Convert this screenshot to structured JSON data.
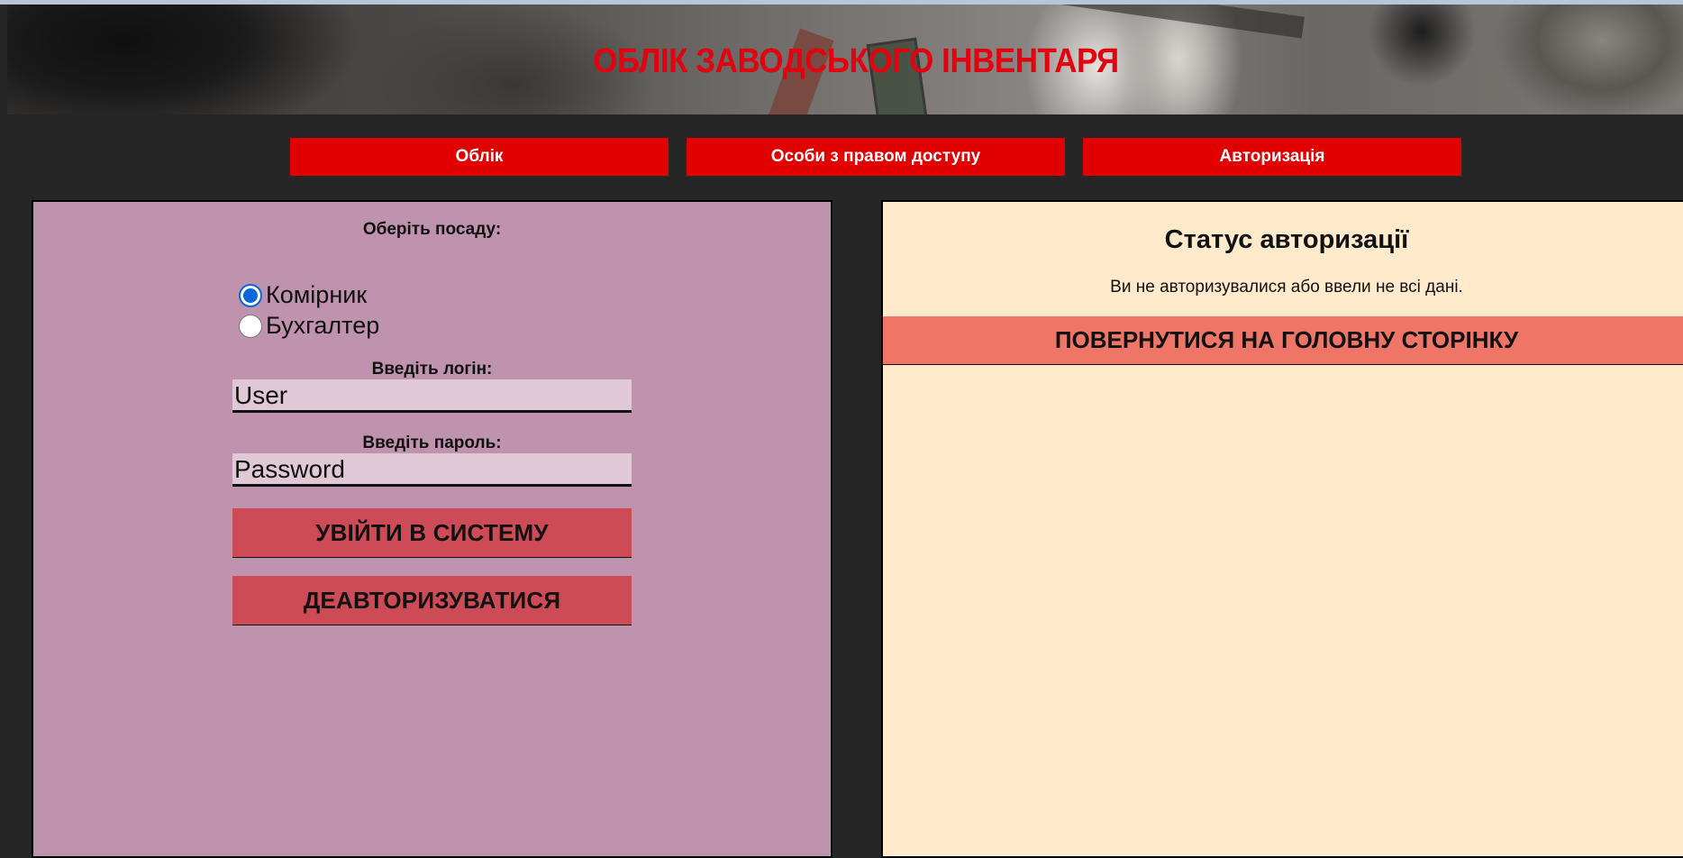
{
  "header": {
    "title": "ОБЛІК ЗАВОДСЬКОГО ІНВЕНТАРЯ"
  },
  "nav": {
    "items": [
      "Облік",
      "Особи з правом доступу",
      "Авторизація"
    ]
  },
  "login_form": {
    "position_label": "Оберіть посаду:",
    "roles": [
      {
        "label": "Комірник",
        "checked": true
      },
      {
        "label": "Бухгалтер",
        "checked": false
      }
    ],
    "login_label": "Введіть логін:",
    "login_value": "User",
    "password_label": "Введіть пароль:",
    "password_value": "Password",
    "login_button": "УВІЙТИ В СИСТЕМУ",
    "logout_button": "ДЕАВТОРИЗУВАТИСЯ"
  },
  "status_panel": {
    "title": "Статус авторизації",
    "message": "Ви не авторизувалися або ввели не всі дані.",
    "home_button": "ПОВЕРНУТИСЯ НА ГОЛОВНУ СТОРІНКУ"
  },
  "colors": {
    "nav_button": "#e00000",
    "header_title": "#e3000f",
    "left_panel": "#bf92ad",
    "right_panel": "#ffeacb",
    "action_button": "#cd4a57",
    "home_button": "#ef7566",
    "radio_selected": "#0a66d9"
  }
}
